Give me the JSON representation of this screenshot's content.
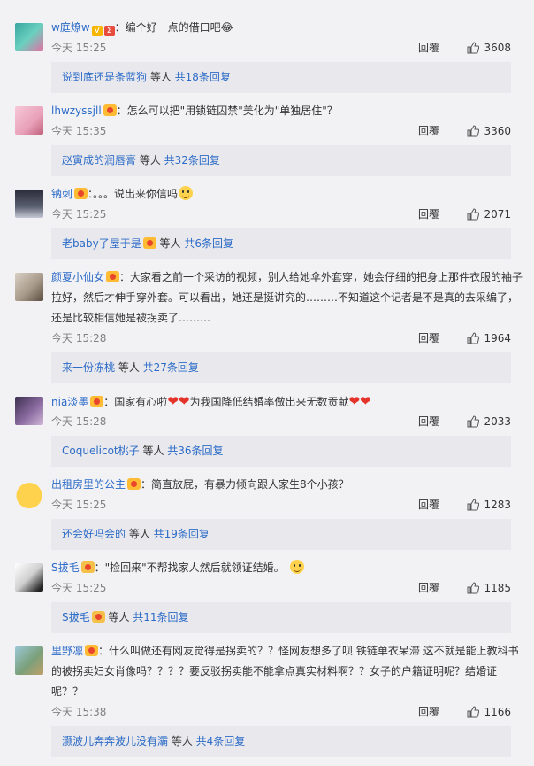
{
  "comments": [
    {
      "username": "w庭燎w",
      "text": "：编个好一点的借口吧😂",
      "time": "今天 15:25",
      "reply_label": "回覆",
      "likes": "3608",
      "sub_user": "说到底还是条蓝狗",
      "sub_middle": " 等人 ",
      "sub_link": "共18条回复"
    },
    {
      "username": "lhwzyssjll",
      "text": "：怎么可以把\"用锁链囚禁\"美化为\"单独居住\"？",
      "time": "今天 15:35",
      "reply_label": "回覆",
      "likes": "3360",
      "sub_user": "赵寅成的润唇膏",
      "sub_middle": " 等人 ",
      "sub_link": "共32条回复"
    },
    {
      "username": "钠刺",
      "text": "：。。。说出来你信吗",
      "time": "今天 15:25",
      "reply_label": "回覆",
      "likes": "2071",
      "sub_user": "老baby了屋于是",
      "sub_middle": " 等人 ",
      "sub_link": "共6条回复"
    },
    {
      "username": "颜夏小仙女",
      "text": "：大家看之前一个采访的视频，别人给她伞外套穿，她会仔细的把身上那件衣服的袖子拉好，然后才伸手穿外套。可以看出，她还是挺讲究的………不知道这个记者是不是真的去采编了，还是比较相信她是被拐卖了………",
      "time": "今天 15:28",
      "reply_label": "回覆",
      "likes": "1964",
      "sub_user": "来一份冻桃",
      "sub_middle": " 等人 ",
      "sub_link": "共27条回复"
    },
    {
      "username": "nia淡墨",
      "text": "：国家有心啦",
      "text2": "为我国降低结婚率做出来无数贡献",
      "time": "今天 15:28",
      "reply_label": "回覆",
      "likes": "2033",
      "sub_user": "Coquelicot桃子",
      "sub_middle": " 等人 ",
      "sub_link": "共36条回复"
    },
    {
      "username": "出租房里的公主",
      "text": "：简直放屁，有暴力倾向跟人家生8个小孩？",
      "time": "今天 15:25",
      "reply_label": "回覆",
      "likes": "1283",
      "sub_user": "还会好吗会的",
      "sub_middle": " 等人 ",
      "sub_link": "共19条回复"
    },
    {
      "username": "S拔毛",
      "text": "：\"捡回来\"不帮找家人然后就领证结婚。",
      "time": "今天 15:25",
      "reply_label": "回覆",
      "likes": "1185",
      "sub_user": "S拔毛",
      "sub_middle": " 等人 ",
      "sub_link": "共11条回复"
    },
    {
      "username": "里野凛",
      "text": "：什么叫做还有网友觉得是拐卖的？？怪网友想多了呗 铁链单衣呆滞 这不就是能上教科书的被拐卖妇女肖像吗？？？？要反驳拐卖能不能拿点真实材料啊？？女子的户籍证明呢？结婚证呢？？",
      "time": "今天 15:38",
      "reply_label": "回覆",
      "likes": "1166",
      "sub_user": "灏波儿奔奔波儿没有灞",
      "sub_middle": " 等人 ",
      "sub_link": "共4条回复"
    }
  ],
  "icons": {
    "like": "thumbs-up-icon",
    "badge": "vip-badge-icon"
  },
  "colors": {
    "link": "#2c6bc7",
    "background": "#f2f2f5",
    "subbox": "#e9e9ed"
  }
}
